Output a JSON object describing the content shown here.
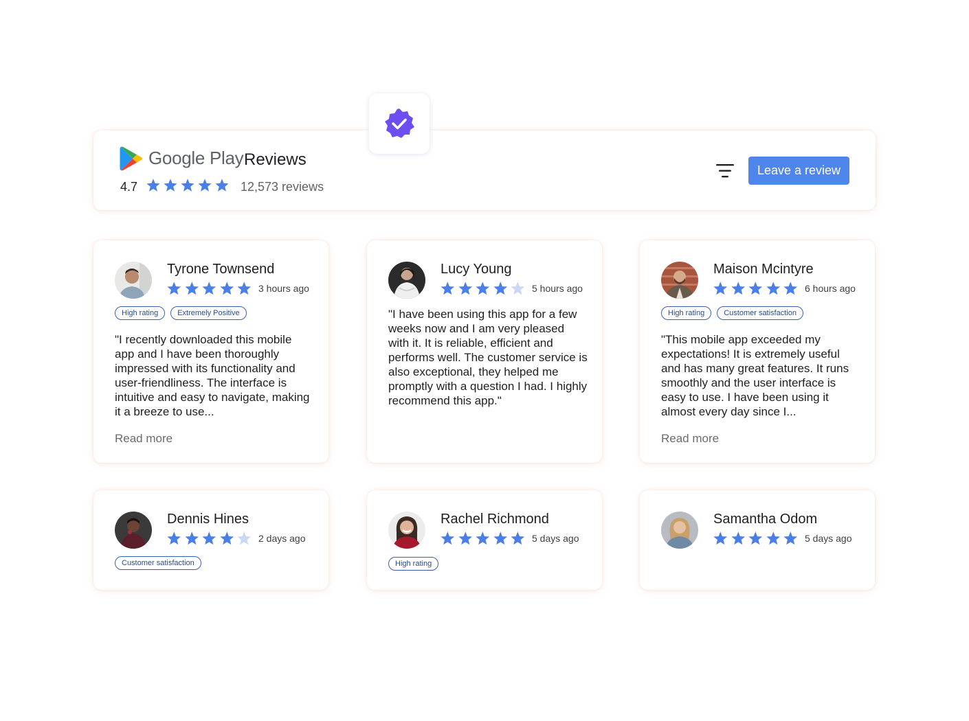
{
  "header": {
    "brand": "Google Play",
    "title": "Reviews",
    "rating": "4.7",
    "stars": 5,
    "review_count": "12,573 reviews",
    "leave_button": "Leave a review"
  },
  "colors": {
    "star": "#4a7fe8",
    "star_empty": "#c9d6f5",
    "accent": "#4f86ec",
    "badge": "#6c4ef2",
    "tag_border": "#3b5fa8"
  },
  "icons": {
    "verified": "verified-badge-icon",
    "filter": "filter-icon",
    "logo": "google-play-logo-icon"
  },
  "reviews": [
    {
      "name": "Tyrone Townsend",
      "stars": 5,
      "time": "3 hours ago",
      "tags": [
        "High rating",
        "Extremely Positive"
      ],
      "text": "\"I recently downloaded this mobile app and I have been thoroughly impressed with its functionality and user-friendliness. The interface is intuitive and easy to navigate, making it a breeze to use...",
      "read_more": "Read more"
    },
    {
      "name": "Lucy Young",
      "stars": 4,
      "time": "5 hours ago",
      "tags": [],
      "text": "\"I have been using this app for a few weeks now and I am very pleased with it. It is reliable, efficient and performs well. The customer service is also exceptional, they helped me promptly with a question I had. I highly recommend this app.\"",
      "read_more": ""
    },
    {
      "name": "Maison Mcintyre",
      "stars": 5,
      "time": "6 hours ago",
      "tags": [
        "High rating",
        "Customer satisfaction"
      ],
      "text": "\"This mobile app exceeded my expectations! It is extremely useful and has many great features. It runs smoothly and the user interface is easy to use. I have been using it almost every day since I...",
      "read_more": "Read more"
    },
    {
      "name": "Dennis Hines",
      "stars": 4,
      "time": "2 days ago",
      "tags": [
        "Customer satisfaction"
      ],
      "text": "",
      "read_more": ""
    },
    {
      "name": "Rachel Richmond",
      "stars": 5,
      "time": "5 days ago",
      "tags": [
        "High rating"
      ],
      "text": "",
      "read_more": ""
    },
    {
      "name": "Samantha Odom",
      "stars": 5,
      "time": "5 days ago",
      "tags": [],
      "text": "",
      "read_more": ""
    }
  ]
}
